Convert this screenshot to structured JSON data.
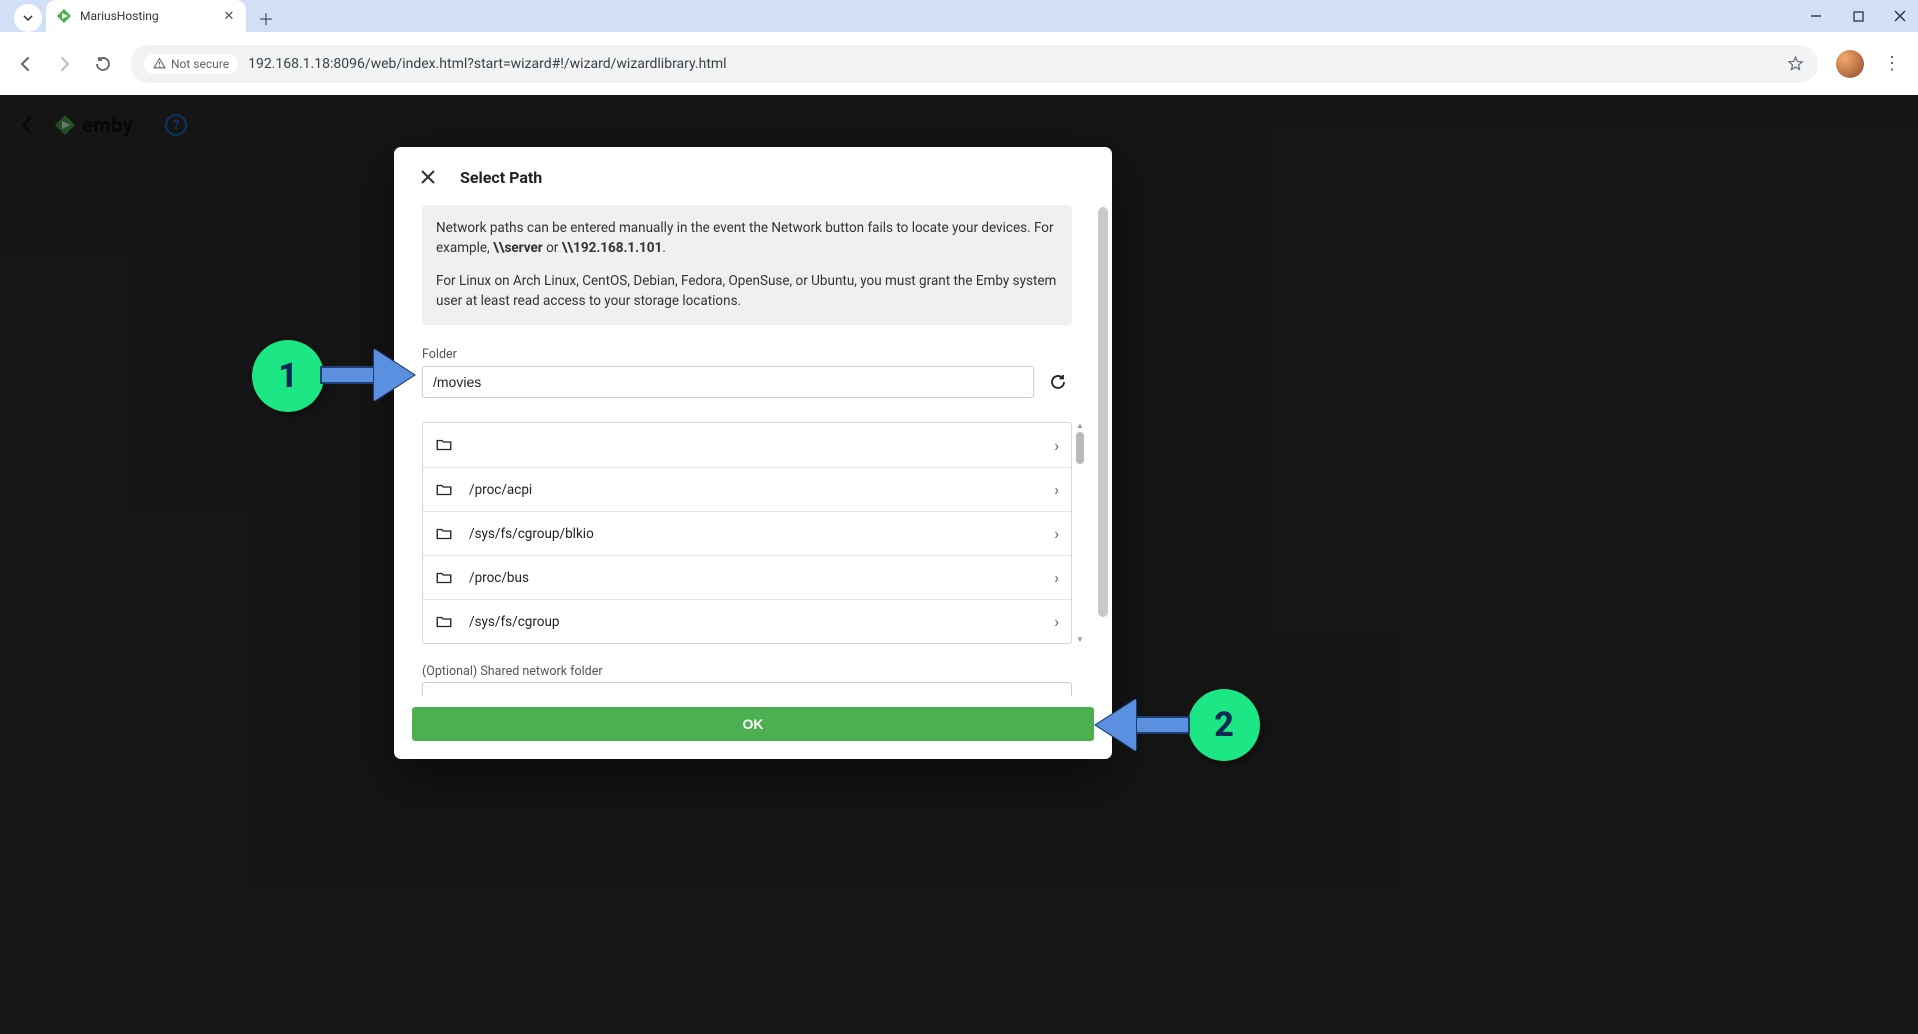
{
  "browser": {
    "tab_title": "MariusHosting",
    "security_label": "Not secure",
    "url": "192.168.1.18:8096/web/index.html?start=wizard#!/wizard/wizardlibrary.html"
  },
  "app": {
    "brand": "emby"
  },
  "dialog": {
    "title": "Select Path",
    "info_line1_a": "Network paths can be entered manually in the event the Network button fails to locate your devices. For example, ",
    "info_line1_b": "\\\\server",
    "info_line1_c": " or ",
    "info_line1_d": "\\\\192.168.1.101",
    "info_line1_e": ".",
    "info_line2": "For Linux on Arch Linux, CentOS, Debian, Fedora, OpenSuse, or Ubuntu, you must grant the Emby system user at least read access to your storage locations.",
    "folder_label": "Folder",
    "folder_value": "/movies",
    "folders": [
      {
        "path": ""
      },
      {
        "path": "/proc/acpi"
      },
      {
        "path": "/sys/fs/cgroup/blkio"
      },
      {
        "path": "/proc/bus"
      },
      {
        "path": "/sys/fs/cgroup"
      }
    ],
    "optional_label": "(Optional) Shared network folder",
    "ok_label": "OK"
  },
  "annotations": {
    "n1": "1",
    "n2": "2"
  }
}
